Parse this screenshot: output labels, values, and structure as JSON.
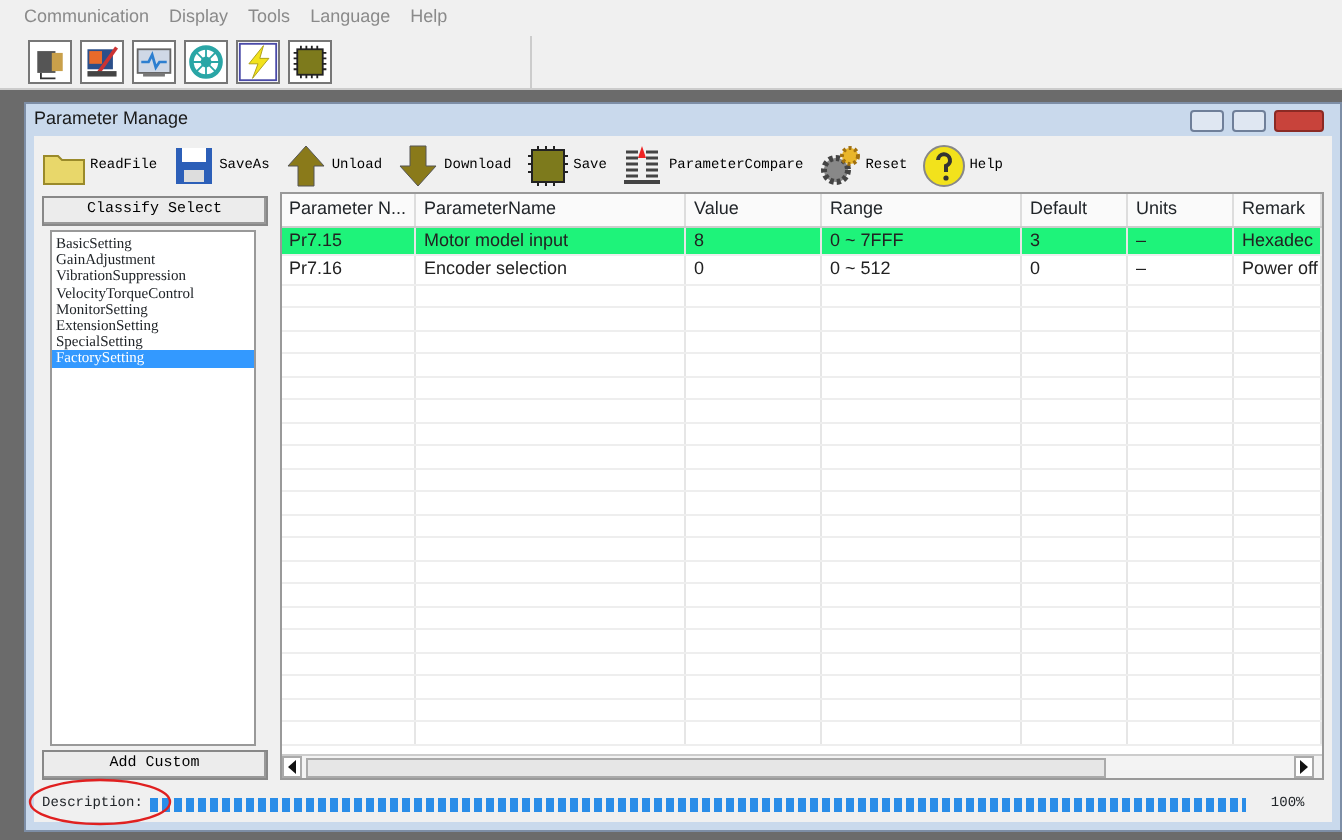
{
  "menu": [
    "Communication",
    "Display",
    "Tools",
    "Language",
    "Help"
  ],
  "window": {
    "title": "Parameter Manage",
    "toolbar": [
      {
        "kind": "folder",
        "label": "ReadFile"
      },
      {
        "kind": "disk",
        "label": "SaveAs"
      },
      {
        "kind": "up",
        "label": "Unload"
      },
      {
        "kind": "down",
        "label": "Download"
      },
      {
        "kind": "chip",
        "label": "Save"
      },
      {
        "kind": "compare",
        "label": "ParameterCompare"
      },
      {
        "kind": "gear",
        "label": "Reset"
      },
      {
        "kind": "help",
        "label": "Help"
      }
    ],
    "classify_button": "Classify Select",
    "categories": [
      {
        "label": "BasicSetting",
        "selected": false
      },
      {
        "label": "GainAdjustment",
        "selected": false
      },
      {
        "label": "VibrationSuppression",
        "selected": false
      },
      {
        "label": "VelocityTorqueControl",
        "selected": false
      },
      {
        "label": "MonitorSetting",
        "selected": false
      },
      {
        "label": "ExtensionSetting",
        "selected": false
      },
      {
        "label": "SpecialSetting",
        "selected": false
      },
      {
        "label": "FactorySetting",
        "selected": true
      }
    ],
    "add_custom_button": "Add Custom",
    "table": {
      "columns": [
        "Parameter N...",
        "ParameterName",
        "Value",
        "Range",
        "Default",
        "Units",
        "Remark"
      ],
      "rows": [
        {
          "cells": [
            "Pr7.15",
            "Motor model input",
            "8",
            "0 ~ 7FFF",
            "3",
            "–",
            "Hexadec"
          ],
          "selected": true
        },
        {
          "cells": [
            "Pr7.16",
            "Encoder selection",
            "0",
            "0 ~ 512",
            "0",
            "–",
            "Power off"
          ],
          "selected": false
        }
      ]
    },
    "status": {
      "label": "Description:",
      "level": 1,
      "reading": "100%"
    }
  }
}
